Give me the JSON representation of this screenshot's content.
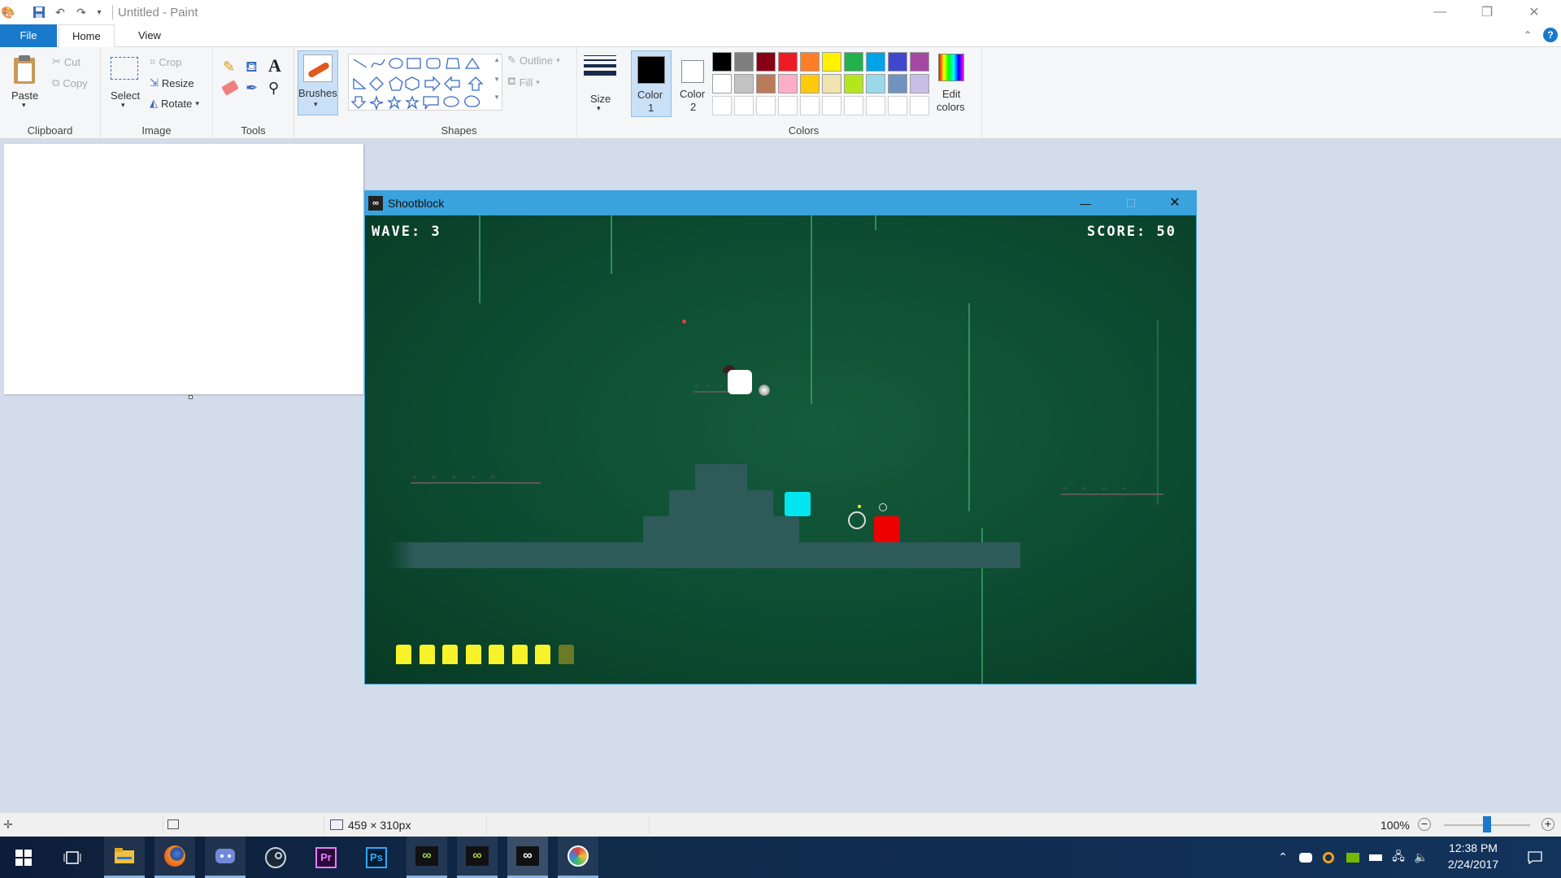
{
  "paint": {
    "title": "Untitled - Paint",
    "tabs": [
      "File",
      "Home",
      "View"
    ],
    "clipboard": {
      "paste": "Paste",
      "cut": "Cut",
      "copy": "Copy",
      "group": "Clipboard"
    },
    "image": {
      "select": "Select",
      "crop": "Crop",
      "resize": "Resize",
      "rotate": "Rotate",
      "group": "Image"
    },
    "tools": {
      "group": "Tools"
    },
    "brushes": "Brushes",
    "shapes": {
      "outline": "Outline",
      "fill": "Fill",
      "group": "Shapes"
    },
    "size": "Size",
    "color1": {
      "label": "Color",
      "num": "1"
    },
    "color2": {
      "label": "Color",
      "num": "2"
    },
    "colors": {
      "group": "Colors",
      "edit_line1": "Edit",
      "edit_line2": "colors"
    },
    "palette_row1": [
      "#000000",
      "#7f7f7f",
      "#880015",
      "#ed1c24",
      "#ff7f27",
      "#fff200",
      "#22b14c",
      "#00a2e8",
      "#3f48cc",
      "#a349a4"
    ],
    "palette_row2": [
      "#ffffff",
      "#c3c3c3",
      "#b97a57",
      "#ffaec9",
      "#ffc90e",
      "#efe4b0",
      "#b5e61d",
      "#99d9ea",
      "#7092be",
      "#c8bfe7"
    ],
    "palette_row3": [
      "#ffffff",
      "#ffffff",
      "#ffffff",
      "#ffffff",
      "#ffffff",
      "#ffffff",
      "#ffffff",
      "#ffffff",
      "#ffffff",
      "#ffffff"
    ],
    "status": {
      "dimensions": "459 × 310px",
      "zoom": "100%",
      "zoom_fraction": 0.5
    }
  },
  "game": {
    "title": "Shootblock",
    "wave": "WAVE: 3",
    "score": "SCORE: 50",
    "ammo_total": 8,
    "ammo_loaded": 7,
    "player_color": "#ffffff",
    "cyan_color": "#00e5ee",
    "enemy_color": "#ee0000",
    "ammo_color": "#f7f22a"
  },
  "taskbar": {
    "apps": [
      "windows-start-icon",
      "task-view-icon",
      "file-explorer-icon",
      "firefox-icon",
      "discord-icon",
      "steam-icon",
      "premiere-icon",
      "photoshop-icon",
      "game-icon-1",
      "game-icon-2",
      "shootblock-icon",
      "paint-icon"
    ],
    "premiere": "Pr",
    "photoshop": "Ps",
    "time": "12:38 PM",
    "date": "2/24/2017"
  }
}
